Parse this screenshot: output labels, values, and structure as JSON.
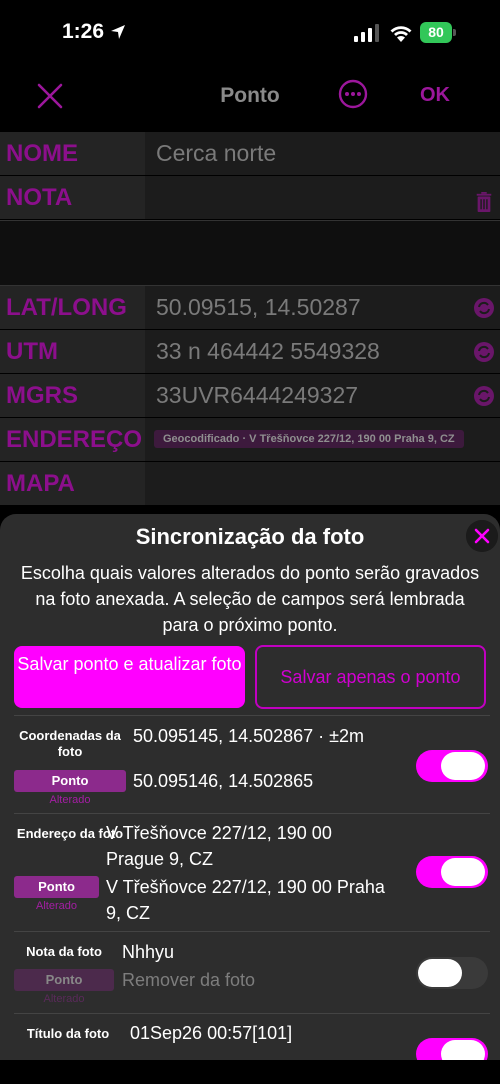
{
  "status": {
    "time": "1:26",
    "battery": "80"
  },
  "nav": {
    "title": "Ponto",
    "ok": "OK"
  },
  "form": {
    "name": {
      "label": "NOME",
      "value": "Cerca norte"
    },
    "nota": {
      "label": "NOTA"
    },
    "latlong": {
      "label": "LAT/LONG",
      "value": "50.09515, 14.50287"
    },
    "utm": {
      "label": "UTM",
      "value": "33 n 464442 5549328"
    },
    "mgrs": {
      "label": "MGRS",
      "value": "33UVR6444249327"
    },
    "endereco": {
      "label": "ENDEREÇO",
      "value": "Geocodificado · V Třešňovce 227/12, 190 00 Praha 9, CZ"
    },
    "mapa": {
      "label": "MAPA"
    }
  },
  "sheet": {
    "title": "Sincronização da foto",
    "description": "Escolha quais valores alterados do ponto serão gravados na foto anexada. A seleção de campos será lembrada para o próximo ponto.",
    "btn_save_update": "Salvar ponto e atualizar foto",
    "btn_save_only": "Salvar apenas o ponto",
    "rows": [
      {
        "label": "Coordenadas da foto",
        "photo_value": "50.095145, 14.502867 · ±2m",
        "chip": "Ponto",
        "status": "Alterado",
        "point_value": "50.095146, 14.502865",
        "toggle": "on"
      },
      {
        "label": "Endereço da foto",
        "photo_value": "V Třešňovce 227/12, 190 00 Prague 9, CZ",
        "chip": "Ponto",
        "status": "Alterado",
        "point_value": "V Třešňovce 227/12, 190 00 Praha 9, CZ",
        "toggle": "on"
      },
      {
        "label": "Nota da foto",
        "photo_value": "Nhhyu",
        "chip": "Ponto",
        "status": "Alterado",
        "point_value": "Remover da foto",
        "toggle": "off"
      },
      {
        "label": "Título da foto",
        "photo_value": "01Sep26 00:57[101]",
        "toggle": "on"
      }
    ]
  },
  "colors": {
    "accent": "#ff00ff",
    "label": "#8c0f8c",
    "background": "#000000",
    "sheet": "#2d2d2d"
  }
}
